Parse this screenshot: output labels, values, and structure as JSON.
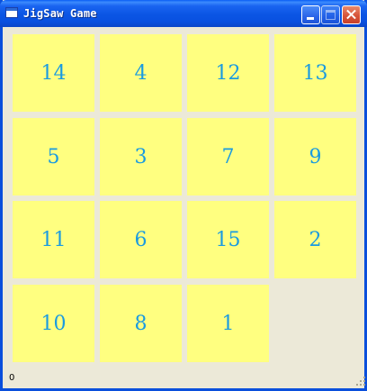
{
  "window": {
    "title": "JigSaw Game"
  },
  "board": {
    "tiles": [
      "14",
      "4",
      "12",
      "13",
      "5",
      "3",
      "7",
      "9",
      "11",
      "6",
      "15",
      "2",
      "10",
      "8",
      "1"
    ],
    "empty_cell": "row 4, column 4"
  },
  "status": {
    "moves": "0"
  },
  "colors": {
    "tile_background": "#ffff80",
    "tile_text": "#1a9be0",
    "window_background": "#ece9d8",
    "titlebar": "#0a55e4"
  }
}
